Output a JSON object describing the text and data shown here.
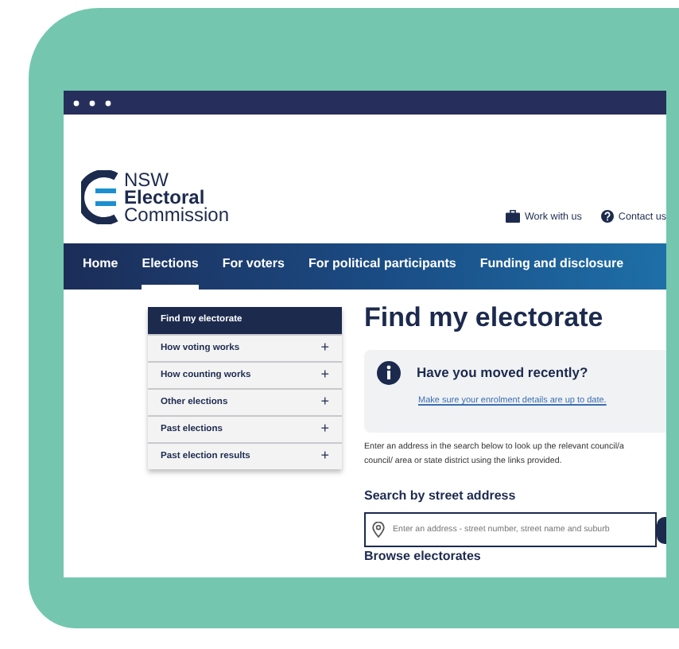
{
  "logo": {
    "lines": [
      "NSW",
      "Electoral",
      "Commission"
    ]
  },
  "utility_links": [
    {
      "kind": "work",
      "label": "Work with us"
    },
    {
      "kind": "help",
      "label": "Contact us"
    }
  ],
  "nav": [
    {
      "label": "Home",
      "selected": false
    },
    {
      "label": "Elections",
      "selected": true
    },
    {
      "label": "For voters",
      "selected": false
    },
    {
      "label": "For political participants",
      "selected": false
    },
    {
      "label": "Funding and disclosure",
      "selected": false
    }
  ],
  "side_menu": [
    {
      "label": "Find my electorate",
      "selected": true,
      "expandable": false
    },
    {
      "label": "How voting works",
      "selected": false,
      "expandable": true
    },
    {
      "label": "How counting works",
      "selected": false,
      "expandable": true
    },
    {
      "label": "Other elections",
      "selected": false,
      "expandable": true
    },
    {
      "label": "Past elections",
      "selected": false,
      "expandable": true
    },
    {
      "label": "Past election results",
      "selected": false,
      "expandable": true
    }
  ],
  "expand_glyph": "+",
  "title": "Find my electorate",
  "notice": {
    "heading": "Have you moved recently?",
    "link": "Make sure your enrolment details are up to date."
  },
  "intro": "Enter an address in the search below to look up the relevant council/a\ncouncil/ area or state district using the links provided.",
  "search": {
    "heading": "Search by street address",
    "placeholder": "Enter an address - street number, street name and suburb"
  },
  "browse_heading": "Browse electorates"
}
